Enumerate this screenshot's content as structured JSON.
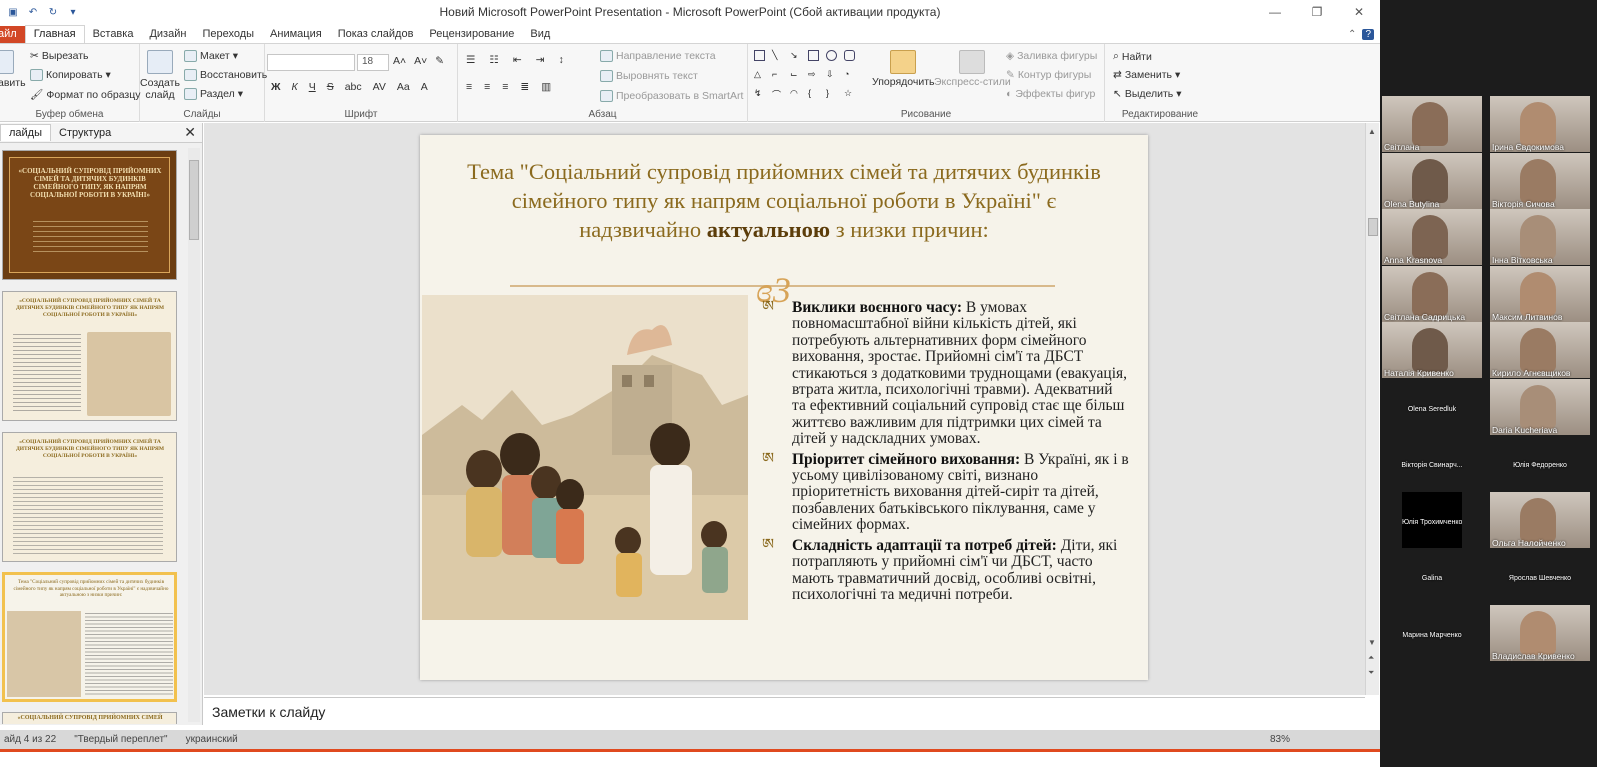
{
  "window": {
    "title": "Новий Microsoft PowerPoint Presentation  -  Microsoft PowerPoint (Сбой активации продукта)",
    "controls": [
      "—",
      "❐",
      "✕"
    ]
  },
  "tabs": [
    "айл",
    "Главная",
    "Вставка",
    "Дизайн",
    "Переходы",
    "Анимация",
    "Показ слайдов",
    "Рецензирование",
    "Вид"
  ],
  "tabs_active": "Главная",
  "ribbon": {
    "clipboard": {
      "paste": "авить",
      "cut": "Вырезать",
      "copy": "Копировать",
      "format_painter": "Формат по образцу",
      "label": "Буфер обмена"
    },
    "slides": {
      "new_slide": "Создать слайд",
      "layout": "Макет",
      "reset": "Восстановить",
      "section": "Раздел",
      "label": "Слайды"
    },
    "font": {
      "font_name": "",
      "font_size": "18",
      "label": "Шрифт",
      "buttons": [
        "Ж",
        "К",
        "Ч",
        "S",
        "abc",
        "AV",
        "Aa",
        "A"
      ]
    },
    "paragraph": {
      "text_direction": "Направление текста",
      "align_text": "Выровнять текст",
      "smartart": "Преобразовать в SmartArt",
      "label": "Абзац"
    },
    "drawing": {
      "arrange": "Упорядочить",
      "quick_styles": "Экспресс-стили",
      "fill": "Заливка фигуры",
      "outline": "Контур фигуры",
      "effects": "Эффекты фигур",
      "label": "Рисование"
    },
    "editing": {
      "find": "Найти",
      "replace": "Заменить",
      "select": "Выделить",
      "label": "Редактирование"
    }
  },
  "left_panel": {
    "tab_slides": "лайды",
    "tab_outline": "Структура",
    "thumb1_title": "«СОЦІАЛЬНИЙ СУПРОВІД ПРИЙОМНИХ СІМЕЙ ТА ДИТЯЧИХ БУДИНКІВ СІМЕЙНОГО ТИПУ, ЯК НАПРЯМ СОЦІАЛЬНОЇ РОБОТИ В УКРАЇНІ»",
    "thumb2_title": "«СОЦІАЛЬНИЙ СУПРОВІД ПРИЙОМНИХ СІМЕЙ ТА ДИТЯЧИХ БУДИНКІВ СІМЕЙНОГО ТИПУ ЯК НАПРЯМ СОЦІАЛЬНОЇ РОБОТИ В УКРАЇНІ»",
    "thumb3_title": "«СОЦІАЛЬНИЙ СУПРОВІД ПРИЙОМНИХ СІМЕЙ ТА ДИТЯЧИХ БУДИНКІВ СІМЕЙНОГО ТИПУ ЯК НАПРЯМ СОЦІАЛЬНОЇ РОБОТИ В УКРАЇНІ»",
    "thumb4_title": "Тема \"Соціальний супровід прийомних сімей та дитячих будинків сімейного типу як напрям соціальної роботи в Україні\" є надзвичайно актуальною з низки причин:",
    "thumb5_title": "«СОЦІАЛЬНИЙ СУПРОВІД ПРИЙОМНИХ СІМЕЙ"
  },
  "slide": {
    "title_part1": "Тема \"Соціальний супровід прийомних сімей та дитячих будинків сімейного типу як напрям соціальної роботи в Україні\" є надзвичайно ",
    "title_bold": "актуальною",
    "title_part2": " з низки причин:",
    "bullet_mark": "ཨ",
    "flourish": "ɞ3",
    "bullets": [
      {
        "head": "Виклики воєнного часу:",
        "text": " В умовах повномасштабної війни кількість дітей, які потребують альтернативних форм сімейного виховання, зростає. Прийомні сім'ї та ДБСТ стикаються з додатковими труднощами (евакуація, втрата житла, психологічні травми). Адекватний та ефективний соціальний супровід стає ще більш життєво важливим для підтримки цих сімей та дітей у надскладних умовах."
      },
      {
        "head": "Пріоритет сімейного виховання:",
        "text": " В Україні, як і в усьому цивілізованому світі, визнано пріоритетність виховання дітей-сиріт та дітей, позбавлених батьківського піклування, саме у сімейних формах."
      },
      {
        "head": "Складність адаптації та потреб дітей:",
        "text": " Діти, які потрапляють у прийомні сім'ї чи ДБСТ, часто мають травматичний досвід, особливі освітні, психологічні та медичні потреби."
      }
    ]
  },
  "notes": {
    "placeholder": "Заметки к слайду"
  },
  "status": {
    "slide": "айд 4 из 22",
    "theme": "\"Твердый переплет\"",
    "lang": "украинский",
    "zoom": "83%"
  },
  "participants": [
    {
      "name": "Світлана"
    },
    {
      "name": "Ірина Євдокимова"
    },
    {
      "name": "Olena Butylina"
    },
    {
      "name": "Вікторія Сичова"
    },
    {
      "name": "Anna Krasnova"
    },
    {
      "name": "Інна Вітковська"
    },
    {
      "name": "Світлана Садрицька"
    },
    {
      "name": "Максим Литвинов"
    },
    {
      "name": "Наталія Кривенко"
    },
    {
      "name": "Кирило Агнєвщиков"
    },
    {
      "name": "Olena Seredluk"
    },
    {
      "name": "Daria Kucheriava"
    },
    {
      "name": "Вікторія Свинарч..."
    },
    {
      "name": "Юлія Федоренко"
    },
    {
      "name": "Юлія Трохимченко"
    },
    {
      "name": "Ольга Налойченко"
    },
    {
      "name": "Galina"
    },
    {
      "name": "Ярослав Шевченко"
    },
    {
      "name": "Марина Марченко"
    },
    {
      "name": "Владислав Кривенко"
    }
  ],
  "colors": {
    "accent": "#2b579a",
    "file_tab": "#d24726",
    "slide_title": "#8b6a1e",
    "flourish": "#d7a357"
  }
}
